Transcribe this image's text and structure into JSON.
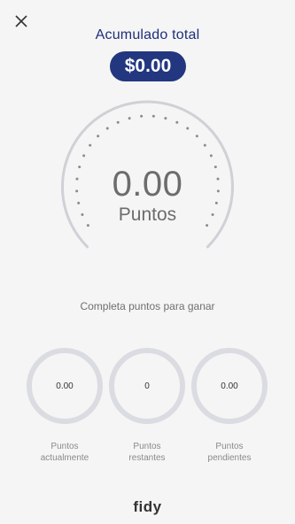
{
  "header": {
    "title": "Acumulado total",
    "amount": "$0.00"
  },
  "gauge": {
    "value": "0.00",
    "label": "Puntos",
    "progress": 0
  },
  "subtitle": "Completa puntos para ganar",
  "stats": [
    {
      "value": "0.00",
      "label_line1": "Puntos",
      "label_line2": "actualmente"
    },
    {
      "value": "0",
      "label_line1": "Puntos",
      "label_line2": "restantes"
    },
    {
      "value": "0.00",
      "label_line1": "Puntos",
      "label_line2": "pendientes"
    }
  ],
  "brand": "fidy",
  "colors": {
    "accent": "#22377f",
    "title": "#1f2f7a",
    "ring": "#dadce2",
    "background": "#f5f5f5"
  },
  "icons": {
    "close": "close-icon"
  }
}
